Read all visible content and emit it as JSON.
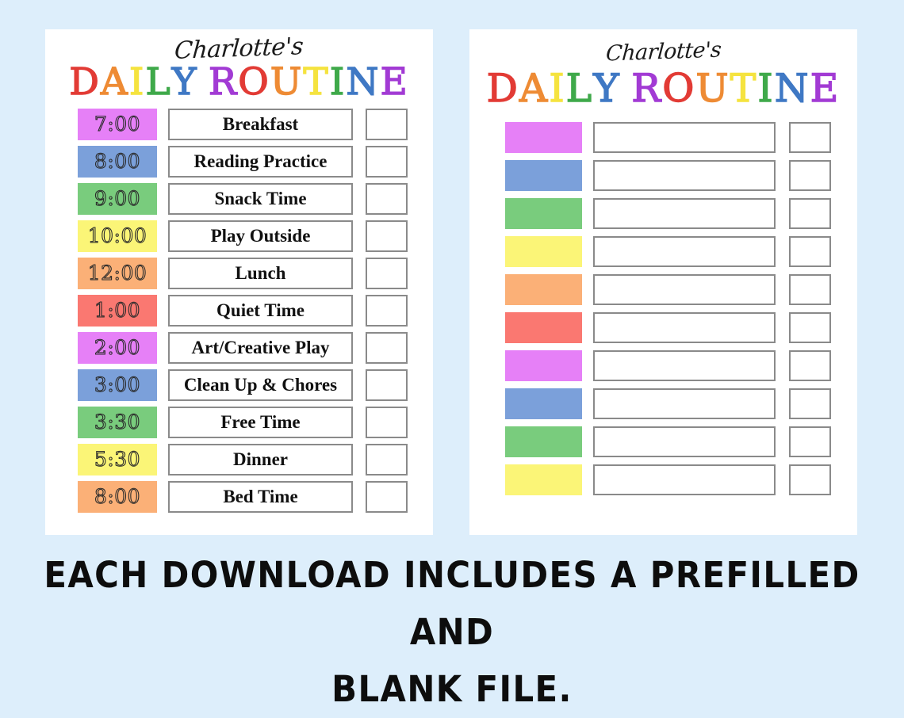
{
  "background_color": "#ddeefb",
  "card_color": "#ffffff",
  "caption": {
    "line1": "EACH DOWNLOAD INCLUDES A PREFILLED AND",
    "line2": "BLANK FILE."
  },
  "title": {
    "script_name": "Charlotte's",
    "main_word_1": "DAILY",
    "main_word_2": "ROUTINE",
    "letter_colors_daily": [
      "#e23b35",
      "#ee8b34",
      "#f5e33f",
      "#3fa94a",
      "#3f78c4",
      "#ffffff"
    ],
    "letter_colors_routine": [
      "#a23bd4",
      "#e23b35",
      "#ee8b34",
      "#f5e33f",
      "#3fa94a",
      "#3f78c4",
      "#a23bd4"
    ],
    "daily_letters": [
      {
        "char": "D",
        "color": "#e23b35"
      },
      {
        "char": "A",
        "color": "#ee8b34"
      },
      {
        "char": "I",
        "color": "#f5e33f"
      },
      {
        "char": "L",
        "color": "#3fa94a"
      },
      {
        "char": "Y",
        "color": "#3f78c4"
      }
    ],
    "routine_letters": [
      {
        "char": "R",
        "color": "#a23bd4"
      },
      {
        "char": "O",
        "color": "#e23b35"
      },
      {
        "char": "U",
        "color": "#ee8b34"
      },
      {
        "char": "T",
        "color": "#f5e33f"
      },
      {
        "char": "I",
        "color": "#3fa94a"
      },
      {
        "char": "N",
        "color": "#3f78c4"
      },
      {
        "char": "E",
        "color": "#a23bd4"
      }
    ]
  },
  "prefilled_card": {
    "label": "Prefilled daily routine chart",
    "rows": [
      {
        "time": "7:00",
        "activity": "Breakfast",
        "color": "#e680f7"
      },
      {
        "time": "8:00",
        "activity": "Reading Practice",
        "color": "#7ba0da"
      },
      {
        "time": "9:00",
        "activity": "Snack Time",
        "color": "#79cc7d"
      },
      {
        "time": "10:00",
        "activity": "Play Outside",
        "color": "#fbf577"
      },
      {
        "time": "12:00",
        "activity": "Lunch",
        "color": "#fbb077"
      },
      {
        "time": "1:00",
        "activity": "Quiet Time",
        "color": "#fa7871"
      },
      {
        "time": "2:00",
        "activity": "Art/Creative Play",
        "color": "#e680f7"
      },
      {
        "time": "3:00",
        "activity": "Clean Up & Chores",
        "color": "#7ba0da"
      },
      {
        "time": "3:30",
        "activity": "Free Time",
        "color": "#79cc7d"
      },
      {
        "time": "5:30",
        "activity": "Dinner",
        "color": "#fbf577"
      },
      {
        "time": "8:00",
        "activity": "Bed Time",
        "color": "#fbb077"
      }
    ]
  },
  "blank_card": {
    "label": "Blank daily routine chart",
    "rows": [
      {
        "time": "",
        "activity": "",
        "color": "#e680f7"
      },
      {
        "time": "",
        "activity": "",
        "color": "#7ba0da"
      },
      {
        "time": "",
        "activity": "",
        "color": "#79cc7d"
      },
      {
        "time": "",
        "activity": "",
        "color": "#fbf577"
      },
      {
        "time": "",
        "activity": "",
        "color": "#fbb077"
      },
      {
        "time": "",
        "activity": "",
        "color": "#fa7871"
      },
      {
        "time": "",
        "activity": "",
        "color": "#e680f7"
      },
      {
        "time": "",
        "activity": "",
        "color": "#7ba0da"
      },
      {
        "time": "",
        "activity": "",
        "color": "#79cc7d"
      },
      {
        "time": "",
        "activity": "",
        "color": "#fbf577"
      }
    ]
  }
}
